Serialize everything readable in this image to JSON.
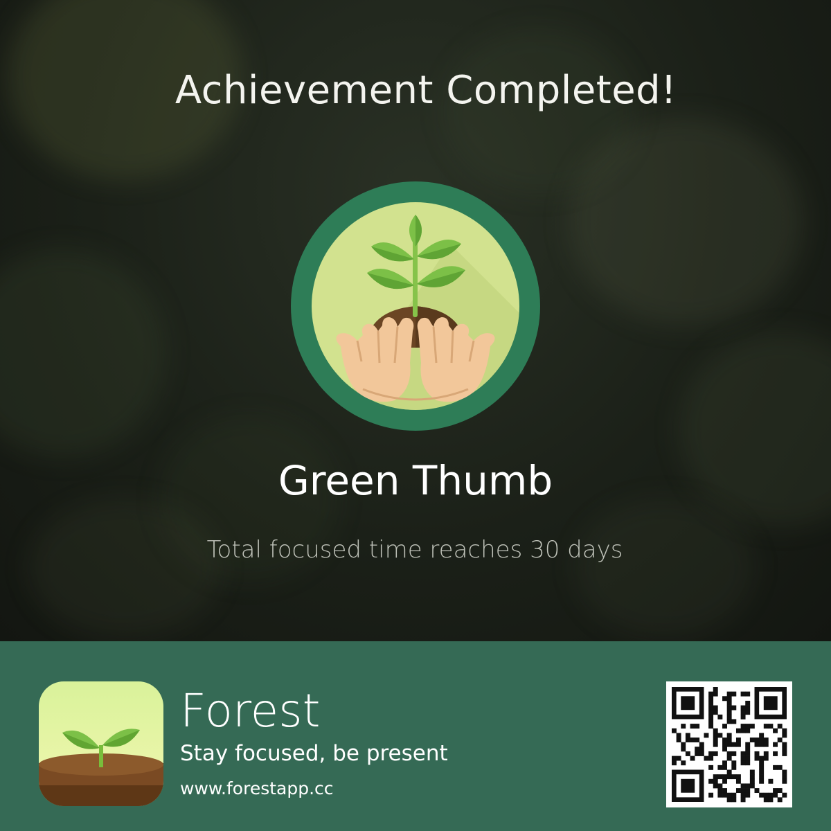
{
  "achievement": {
    "heading": "Achievement Completed!",
    "name": "Green Thumb",
    "description": "Total focused time reaches 30 days",
    "badge_icon": "plant-in-hands-icon"
  },
  "brand": {
    "app_name": "Forest",
    "tagline": "Stay focused, be present",
    "website": "www.forestapp.cc",
    "app_icon": "sprout-app-icon",
    "qr_icon": "qr-code"
  },
  "colors": {
    "footer_bg": "#356a55",
    "badge_ring": "#2e7d57",
    "badge_inner": "#d2e28f",
    "leaf": "#7cc047",
    "soil": "#6b4524"
  }
}
